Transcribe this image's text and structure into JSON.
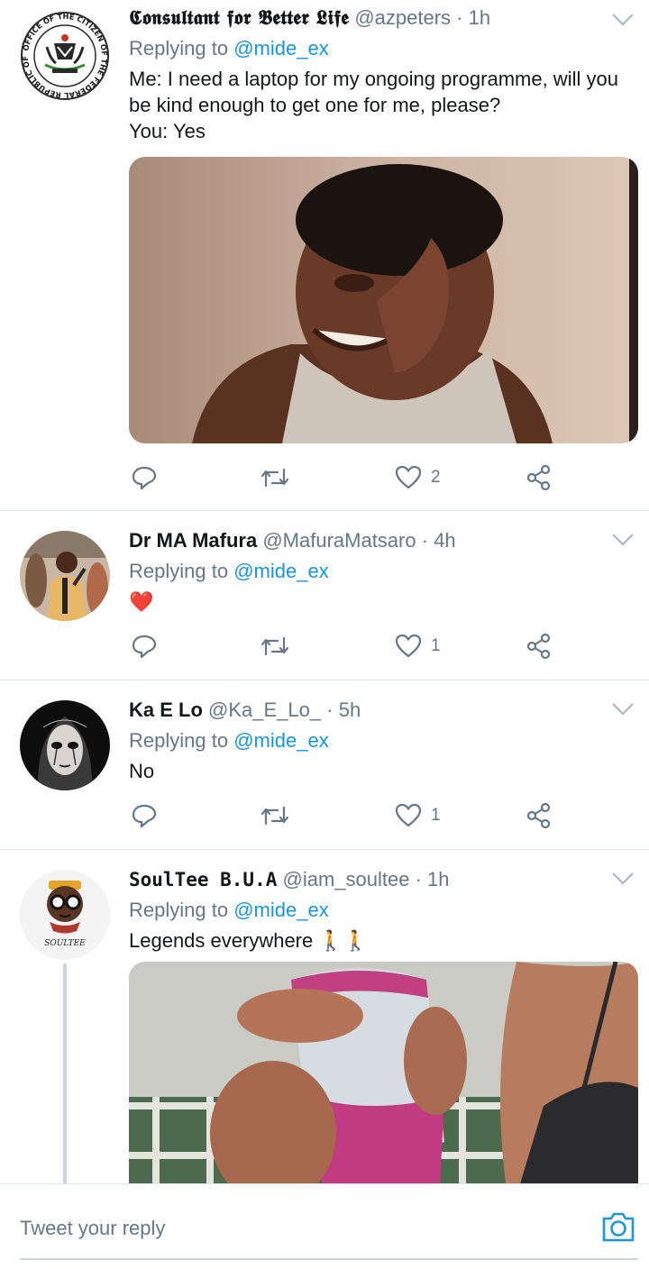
{
  "tweets": [
    {
      "display_name": "𝕮𝖔𝖓𝖘𝖚𝖑𝖙𝖆𝖓𝖙 𝖋𝖔𝖗 𝕭𝖊𝖙𝖙𝖊𝖗 𝕷𝖎𝖋𝖊",
      "handle": "@azpeters",
      "time": "1h",
      "replying_prefix": "Replying to",
      "replying_to": "@mide_ex",
      "text_line1": "Me: I need a laptop for my ongoing programme, will you",
      "text_line2": "be kind enough to get one for me, please?",
      "text_line3": "You: Yes",
      "likes": "2",
      "avatar_seal_text": "OFFICE OF THE CITIZEN OF THE FEDERAL REPUBLIC OF NIGERIA"
    },
    {
      "display_name": "Dr MA Mafura",
      "handle": "@MafuraMatsaro",
      "time": "4h",
      "replying_prefix": "Replying to",
      "replying_to": "@mide_ex",
      "text": "❤️",
      "likes": "1"
    },
    {
      "display_name": "Ka E Lo",
      "handle": "@Ka_E_Lo_",
      "time": "5h",
      "replying_prefix": "Replying to",
      "replying_to": "@mide_ex",
      "text": "No",
      "likes": "1"
    },
    {
      "display_name": "SoulTee B.U.A",
      "handle": "@iam_soultee",
      "time": "1h",
      "replying_prefix": "Replying to",
      "replying_to": "@mide_ex",
      "text": "Legends everywhere 🚶🚶",
      "avatar_signature": "SOULTEE"
    }
  ],
  "separator": "·",
  "composer": {
    "placeholder": "Tweet your reply"
  },
  "icons": {
    "reply": "reply-icon",
    "retweet": "retweet-icon",
    "like": "heart-icon",
    "share": "share-icon",
    "menu": "chevron-down-icon",
    "camera": "camera-icon"
  },
  "colors": {
    "accent": "#1b95e0",
    "secondary_text": "#657786",
    "icon": "#657786",
    "divider": "#e1e8ed"
  }
}
